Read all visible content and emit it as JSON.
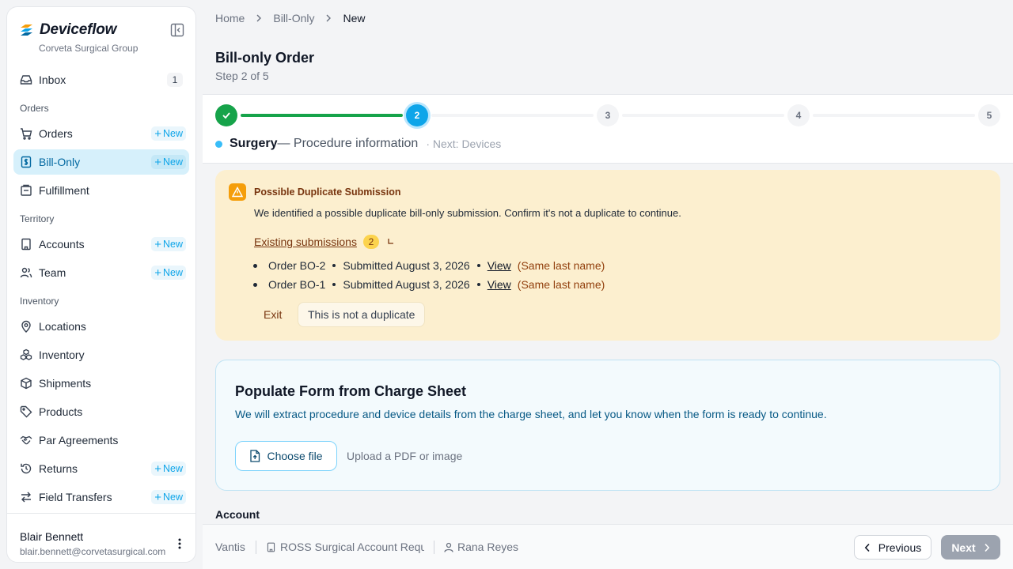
{
  "sidebar": {
    "brand": "Deviceflow",
    "org": "Corveta Surgical Group",
    "inbox": {
      "label": "Inbox",
      "count": "1"
    },
    "sections": {
      "orders": "Orders",
      "territory": "Territory",
      "inventory": "Inventory"
    },
    "new_label": "New",
    "items": {
      "orders": "Orders",
      "bill_only": "Bill-Only",
      "fulfillment": "Fulfillment",
      "accounts": "Accounts",
      "team": "Team",
      "locations": "Locations",
      "inventory": "Inventory",
      "shipments": "Shipments",
      "products": "Products",
      "par_agreements": "Par Agreements",
      "returns": "Returns",
      "field_transfers": "Field Transfers"
    },
    "user": {
      "name": "Blair Bennett",
      "email": "blair.bennett@corvetasurgical.com"
    }
  },
  "breadcrumb": [
    "Home",
    "Bill-Only",
    "New"
  ],
  "page": {
    "title": "Bill-only Order",
    "subtitle": "Step 2 of 5"
  },
  "stepper": {
    "steps": [
      "1",
      "2",
      "3",
      "4",
      "5"
    ],
    "current_step": 2,
    "current_name": "Surgery",
    "current_desc": "— Procedure information",
    "next": "· Next: Devices"
  },
  "warning": {
    "title": "Possible Duplicate Submission",
    "text": "We identified a possible duplicate bill-only submission. Confirm it's not a duplicate to continue.",
    "existing_label": "Existing submissions",
    "existing_count": "2",
    "submissions": [
      {
        "order": "Order BO-2",
        "submitted": "Submitted August 3, 2026",
        "view": "View",
        "note": "(Same last name)"
      },
      {
        "order": "Order BO-1",
        "submitted": "Submitted August 3, 2026",
        "view": "View",
        "note": "(Same last name)"
      }
    ],
    "exit_label": "Exit",
    "not_duplicate_label": "This is not a duplicate"
  },
  "charge_sheet": {
    "title": "Populate Form from Charge Sheet",
    "text": "We will extract procedure and device details from the charge sheet, and let you know when the form is ready to continue.",
    "button": "Choose file",
    "hint": "Upload a PDF or image"
  },
  "account_label": "Account",
  "footer": {
    "vendor": "Vantis",
    "account": "ROSS Surgical Account Requ",
    "rep": "Rana Reyes",
    "previous": "Previous",
    "next": "Next"
  },
  "colors": {
    "accent": "#0ea5e9",
    "done": "#16a34a",
    "warning_bg": "#fcefcf",
    "active_nav": "#d6f0fb"
  }
}
